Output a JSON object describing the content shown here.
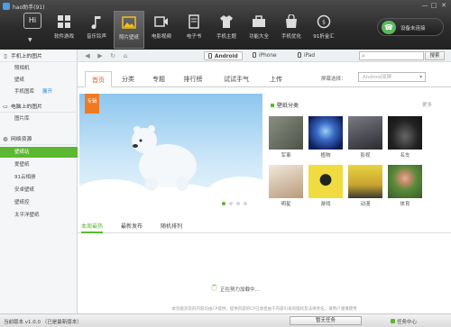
{
  "window": {
    "title": "hao助手(91)",
    "minimize": "—",
    "maximize": "□",
    "close": "✕"
  },
  "logo": "Hi",
  "nav": [
    {
      "label": "软件游戏",
      "icon": "apps-grid-icon"
    },
    {
      "label": "音乐铃声",
      "icon": "music-note-icon"
    },
    {
      "label": "照片壁纸",
      "icon": "picture-icon"
    },
    {
      "label": "电影视频",
      "icon": "film-icon"
    },
    {
      "label": "电子书",
      "icon": "book-icon"
    },
    {
      "label": "手机主题",
      "icon": "shirt-icon"
    },
    {
      "label": "功能大全",
      "icon": "toolbox-icon"
    },
    {
      "label": "手机优化",
      "icon": "shopping-bag-icon"
    },
    {
      "label": "91折金汇",
      "icon": "coin-icon"
    }
  ],
  "device": {
    "status": "设备未连接",
    "icon": "phone-icon"
  },
  "sidebar": {
    "sections": [
      {
        "label": "手机上的图片",
        "icon": "phone-icon",
        "items": [
          {
            "label": "照相机"
          },
          {
            "label": "壁纸"
          },
          {
            "label": "手机图库",
            "extra": "展开"
          }
        ]
      },
      {
        "label": "电脑上的图片",
        "icon": "computer-icon",
        "items": [
          {
            "label": "图片库"
          }
        ]
      },
      {
        "label": "网络资源",
        "icon": "globe-icon",
        "items": [
          {
            "label": "壁纸站"
          },
          {
            "label": "爱壁纸"
          },
          {
            "label": "91云相册"
          },
          {
            "label": "安卓壁纸"
          },
          {
            "label": "壁纸控"
          },
          {
            "label": "太平洋壁纸"
          }
        ]
      }
    ]
  },
  "toolbar": {
    "device_tabs": [
      "Android",
      "iPhone",
      "iPad"
    ],
    "search_label": "搜索",
    "search_placeholder": ""
  },
  "tabs": [
    "首页",
    "分类",
    "专题",
    "排行榜",
    "试试手气",
    "上传"
  ],
  "screen": {
    "label": "屏幕选择：",
    "value": "Android双屏"
  },
  "banner": {
    "tag": "专辑"
  },
  "categories": {
    "title": "壁纸分类",
    "more": "更多",
    "items": [
      {
        "label": "军事",
        "color": "#6a6e66"
      },
      {
        "label": "植物",
        "color": "#1e3c8a"
      },
      {
        "label": "影视",
        "color": "#4a4a52"
      },
      {
        "label": "名车",
        "color": "#2a2a2a"
      },
      {
        "label": "明星",
        "color": "#d9c7b0"
      },
      {
        "label": "游戏",
        "color": "#e8d23a"
      },
      {
        "label": "动漫",
        "color": "#d8c440"
      },
      {
        "label": "体育",
        "color": "#7a9a5a"
      }
    ]
  },
  "sort_tabs": [
    "本周最热",
    "最新发布",
    "随机排列"
  ],
  "loading": "正在努力加载中...",
  "disclaimer": "本功能涉及的内容均由CP提供，提供内容的CP已承担由于内容引发的版权及法律责任，请用户谨慎使用",
  "statusbar": {
    "version": "当前版本 v1.0.0 （已是最新版本）",
    "pause": "暂无任务",
    "tasks": "任务中心"
  },
  "accent": "#5bb830"
}
